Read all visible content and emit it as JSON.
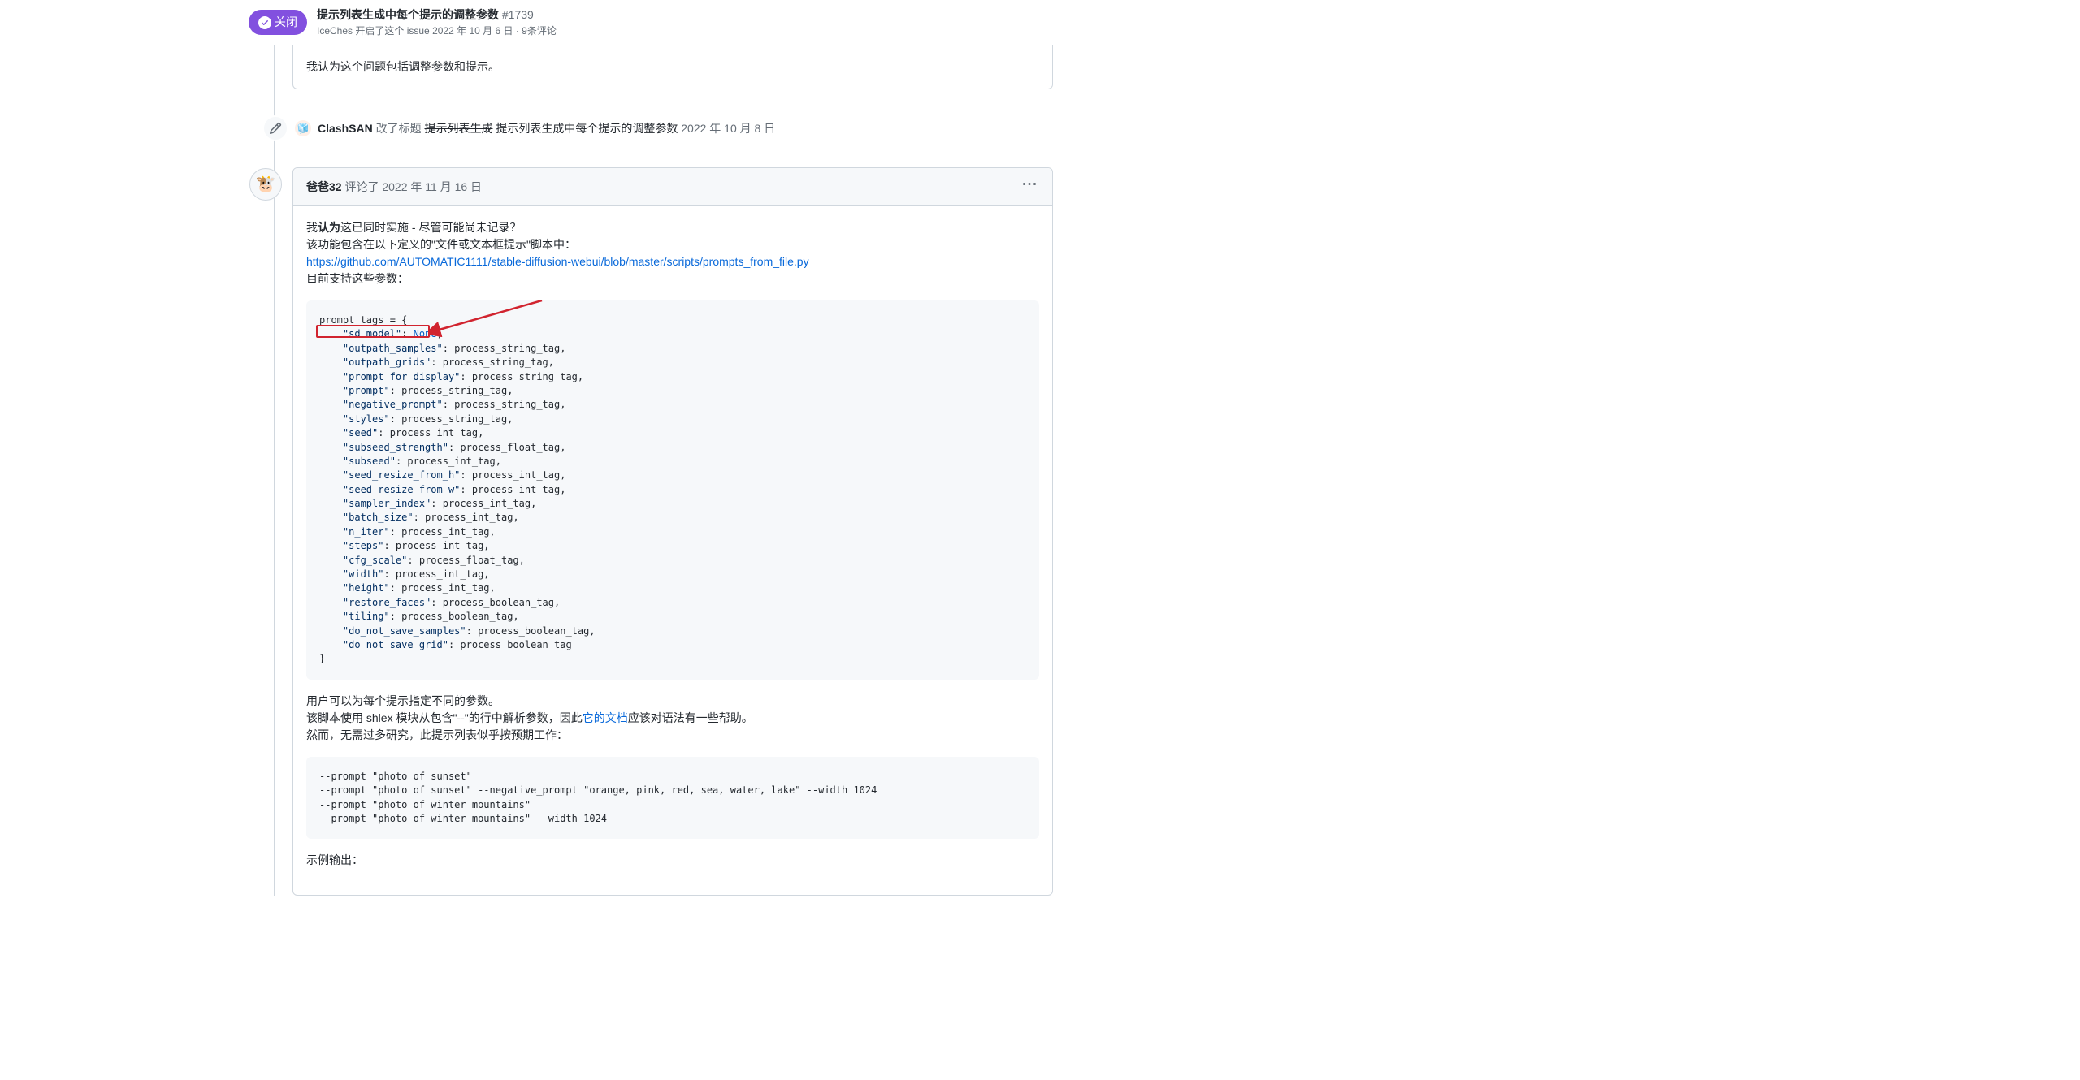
{
  "header": {
    "status_label": "关闭",
    "title": "提示列表生成中每个提示的调整参数",
    "issue_number": "#1739",
    "meta_author": "IceChes",
    "meta_action": "开启了这个 issue",
    "meta_date": "2022 年 10 月 6 日",
    "meta_comments": "9条评论"
  },
  "first_comment_snippet": "我认为这个问题包括调整参数和提示。",
  "timeline_event": {
    "author": "ClashSAN",
    "action": "改了标题",
    "old_title": "提示列表生成",
    "new_title": "提示列表生成中每个提示的调整参数",
    "date": "2022 年 10 月 8 日"
  },
  "comment": {
    "author": "爸爸32",
    "action": "评论了",
    "date": "2022 年 11 月 16 日",
    "p1_prefix": "我",
    "p1_bold": "认为",
    "p1_rest": "这已同时实施 - 尽管可能尚未记录？",
    "p2": "该功能包含在以下定义的\"文件或文本框提示\"脚本中：",
    "link": "https://github.com/AUTOMATIC1111/stable-diffusion-webui/blob/master/scripts/prompts_from_file.py",
    "p3": "目前支持这些参数：",
    "code1_line1": "prompt_tags = {",
    "code1_entries": [
      {
        "key": "\"sd_model\"",
        "val": "None"
      },
      {
        "key": "\"outpath_samples\"",
        "val": "process_string_tag"
      },
      {
        "key": "\"outpath_grids\"",
        "val": "process_string_tag"
      },
      {
        "key": "\"prompt_for_display\"",
        "val": "process_string_tag"
      },
      {
        "key": "\"prompt\"",
        "val": "process_string_tag"
      },
      {
        "key": "\"negative_prompt\"",
        "val": "process_string_tag"
      },
      {
        "key": "\"styles\"",
        "val": "process_string_tag"
      },
      {
        "key": "\"seed\"",
        "val": "process_int_tag"
      },
      {
        "key": "\"subseed_strength\"",
        "val": "process_float_tag"
      },
      {
        "key": "\"subseed\"",
        "val": "process_int_tag"
      },
      {
        "key": "\"seed_resize_from_h\"",
        "val": "process_int_tag"
      },
      {
        "key": "\"seed_resize_from_w\"",
        "val": "process_int_tag"
      },
      {
        "key": "\"sampler_index\"",
        "val": "process_int_tag"
      },
      {
        "key": "\"batch_size\"",
        "val": "process_int_tag"
      },
      {
        "key": "\"n_iter\"",
        "val": "process_int_tag"
      },
      {
        "key": "\"steps\"",
        "val": "process_int_tag"
      },
      {
        "key": "\"cfg_scale\"",
        "val": "process_float_tag"
      },
      {
        "key": "\"width\"",
        "val": "process_int_tag"
      },
      {
        "key": "\"height\"",
        "val": "process_int_tag"
      },
      {
        "key": "\"restore_faces\"",
        "val": "process_boolean_tag"
      },
      {
        "key": "\"tiling\"",
        "val": "process_boolean_tag"
      },
      {
        "key": "\"do_not_save_samples\"",
        "val": "process_boolean_tag"
      },
      {
        "key": "\"do_not_save_grid\"",
        "val": "process_boolean_tag"
      }
    ],
    "code1_last": "}",
    "p4": "用户可以为每个提示指定不同的参数。",
    "p5_a": "该脚本使用 shlex 模块从包含\"--\"的行中解析参数，因此",
    "p5_link": "它的文档",
    "p5_b": "应该对语法有一些帮助。",
    "p6": "然而，无需过多研究，此提示列表似乎按预期工作：",
    "code2": "--prompt \"photo of sunset\"\n--prompt \"photo of sunset\" --negative_prompt \"orange, pink, red, sea, water, lake\" --width 1024\n--prompt \"photo of winter mountains\"\n--prompt \"photo of winter mountains\" --width 1024",
    "p7": "示例输出："
  }
}
